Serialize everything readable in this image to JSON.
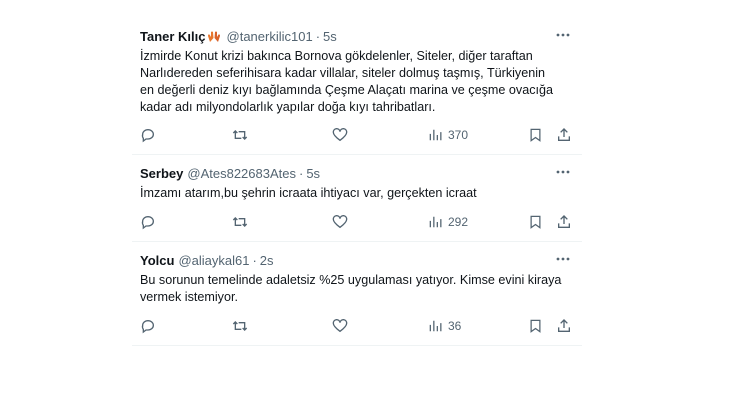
{
  "tweets": [
    {
      "name": "Taner Kılıç",
      "handle": "@tanerkilic101",
      "separator": "·",
      "time": "5s",
      "text": "İzmirde Konut krizi bakınca Bornova gökdelenler,  Siteler, diğer taraftan\nNarlıdereden seferihisara kadar  villalar, siteler dolmuş taşmış, Türkiyenin\nen değerli deniz kıyı bağlamında Çeşme Alaçatı marina ve çeşme ovacığa\nkadar adı milyondolarlık yapılar doğa kıyı tahribatları.",
      "views": "370"
    },
    {
      "name": "Serbey",
      "handle": "@Ates822683Ates",
      "separator": "·",
      "time": "5s",
      "text": "İmzamı atarım,bu şehrin icraata ihtiyacı var, gerçekten icraat",
      "views": "292"
    },
    {
      "name": "Yolcu",
      "handle": "@aliaykal61",
      "separator": "·",
      "time": "2s",
      "text": "Bu sorunun temelinde adaletsiz %25 uygulaması yatıyor. Kimse evini kiraya\nvermek istemiyor.",
      "views": "36"
    }
  ],
  "colors": {
    "text": "#0f1419",
    "muted": "#536471",
    "divider": "#eff3f4",
    "emoji": "#e8772e"
  },
  "icons": [
    "more-icon",
    "reply-icon",
    "retweet-icon",
    "like-icon",
    "views-icon",
    "bookmark-icon",
    "share-icon",
    "hands-emoji-icon"
  ]
}
